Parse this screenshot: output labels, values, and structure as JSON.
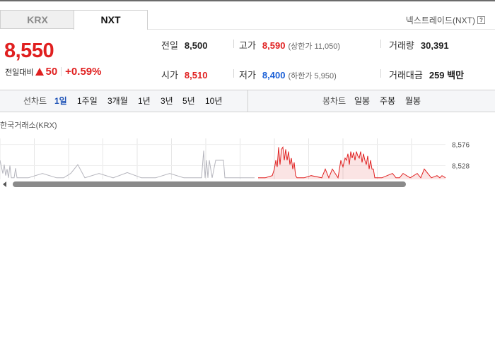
{
  "tabs": [
    {
      "label": "KRX",
      "active": false
    },
    {
      "label": "NXT",
      "active": true
    }
  ],
  "nxt_info": {
    "label": "넥스트레이드(NXT)",
    "help_glyph": "?"
  },
  "quote": {
    "price": "8,550",
    "change_label": "전일대비",
    "change_value": "50",
    "change_percent": "+0.59%",
    "direction": "up"
  },
  "stats": {
    "prev_close": {
      "label": "전일",
      "value": "8,500"
    },
    "high": {
      "label": "고가",
      "value": "8,590",
      "sub": "(상한가 11,050)"
    },
    "volume": {
      "label": "거래량",
      "value": "30,391"
    },
    "open": {
      "label": "시가",
      "value": "8,510"
    },
    "low": {
      "label": "저가",
      "value": "8,400",
      "sub": "(하한가 5,950)"
    },
    "amount": {
      "label": "거래대금",
      "value": "259 백만"
    }
  },
  "toolbar": {
    "line_chart_label": "선차트",
    "periods": [
      "1일",
      "1주일",
      "3개월",
      "1년",
      "3년",
      "5년",
      "10년"
    ],
    "active_period": "1일",
    "candle_chart_label": "봉차트",
    "candle_periods": [
      "일봉",
      "주봉",
      "월봉"
    ]
  },
  "chart_data": {
    "type": "line",
    "title": "",
    "exchange_label": "한국거래소(KRX)",
    "yticks": [
      "8,576",
      "8,528"
    ],
    "ylim": [
      8490,
      8590
    ],
    "series": [
      {
        "color": "#b5b5bd",
        "x": [
          0,
          4,
          6,
          8,
          10,
          12,
          14,
          16,
          18,
          20,
          22,
          24,
          26,
          30,
          40,
          60,
          80,
          90,
          100,
          110,
          120,
          140,
          160,
          180,
          200,
          220,
          240,
          260,
          280,
          285,
          288,
          290,
          292,
          294,
          296,
          300,
          305,
          310,
          314,
          316,
          318,
          320,
          330,
          340,
          350,
          360
        ],
        "y": [
          8540,
          8510,
          8530,
          8505,
          8520,
          8500,
          8528,
          8500,
          8500,
          8500,
          8522,
          8500,
          8500,
          8500,
          8500,
          8510,
          8500,
          8500,
          8510,
          8530,
          8500,
          8510,
          8500,
          8512,
          8500,
          8500,
          8510,
          8500,
          8500,
          8500,
          8562,
          8500,
          8540,
          8500,
          8540,
          8500,
          8540,
          8540,
          8540,
          8540,
          8500,
          8500,
          8500,
          8500,
          8500,
          8500
        ]
      },
      {
        "color": "#e02020",
        "x": [
          365,
          375,
          385,
          388,
          390,
          392,
          394,
          396,
          398,
          400,
          402,
          404,
          406,
          408,
          410,
          412,
          414,
          416,
          418,
          420,
          425,
          430,
          440,
          455,
          460,
          465,
          470,
          478,
          482,
          485,
          488,
          490,
          492,
          494,
          496,
          498,
          500,
          502,
          504,
          506,
          508,
          510,
          512,
          514,
          516,
          518,
          520,
          522,
          524,
          526,
          528,
          530,
          540,
          555,
          560,
          565,
          570,
          580,
          590,
          595,
          600,
          610,
          618,
          622,
          625,
          630
        ],
        "y": [
          8500,
          8500,
          8505,
          8520,
          8540,
          8525,
          8570,
          8530,
          8565,
          8570,
          8540,
          8565,
          8540,
          8560,
          8530,
          8545,
          8520,
          8535,
          8505,
          8500,
          8500,
          8500,
          8505,
          8500,
          8520,
          8500,
          8520,
          8500,
          8540,
          8525,
          8545,
          8540,
          8555,
          8530,
          8560,
          8545,
          8558,
          8540,
          8560,
          8550,
          8545,
          8560,
          8535,
          8555,
          8540,
          8530,
          8550,
          8520,
          8540,
          8520,
          8520,
          8500,
          8500,
          8510,
          8500,
          8500,
          8510,
          8500,
          8510,
          8500,
          8520,
          8500,
          8505,
          8500,
          8505,
          8500
        ]
      }
    ]
  }
}
